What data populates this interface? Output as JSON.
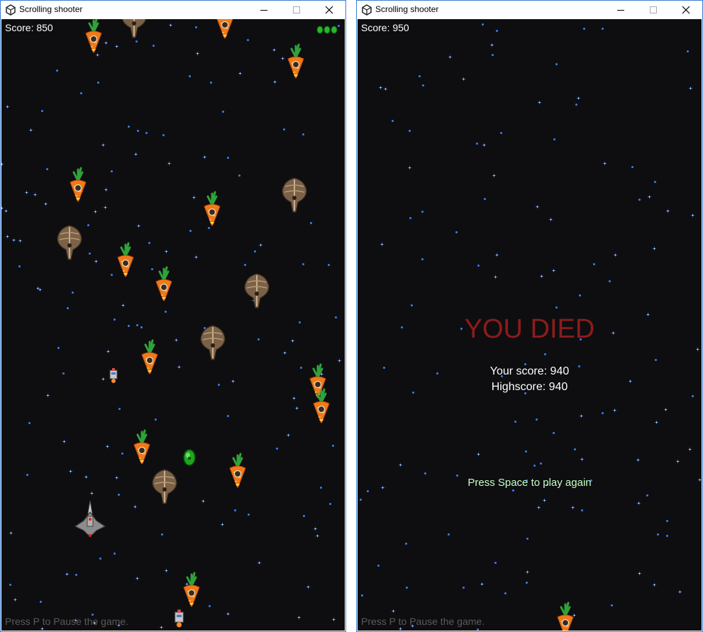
{
  "windows": [
    {
      "id": "left",
      "title": "Scrolling shooter",
      "score_text": "Score: 850",
      "lives": 3,
      "hint": "Press P to Pause the game."
    },
    {
      "id": "right",
      "title": "Scrolling shooter",
      "score_text": "Score: 950",
      "hint": "Press P to Pause the game.",
      "game_over": {
        "title": "YOU DIED",
        "your_score": "Your score: 940",
        "highscore": "Highscore: 940",
        "prompt": "Press Space to play again"
      }
    }
  ],
  "colors": {
    "background": "#0e0e10",
    "star": "#3a7bff",
    "died": "#8e1b1b",
    "prompt": "#c6ffc6",
    "window_border": "#3c7fd0"
  },
  "icons": {
    "enemy_a": "carrot-icon",
    "enemy_b": "beetle-ship-icon",
    "player": "player-ship-icon",
    "powerup": "green-gem-icon",
    "life": "life-orb-icon",
    "drone": "drone-icon"
  }
}
